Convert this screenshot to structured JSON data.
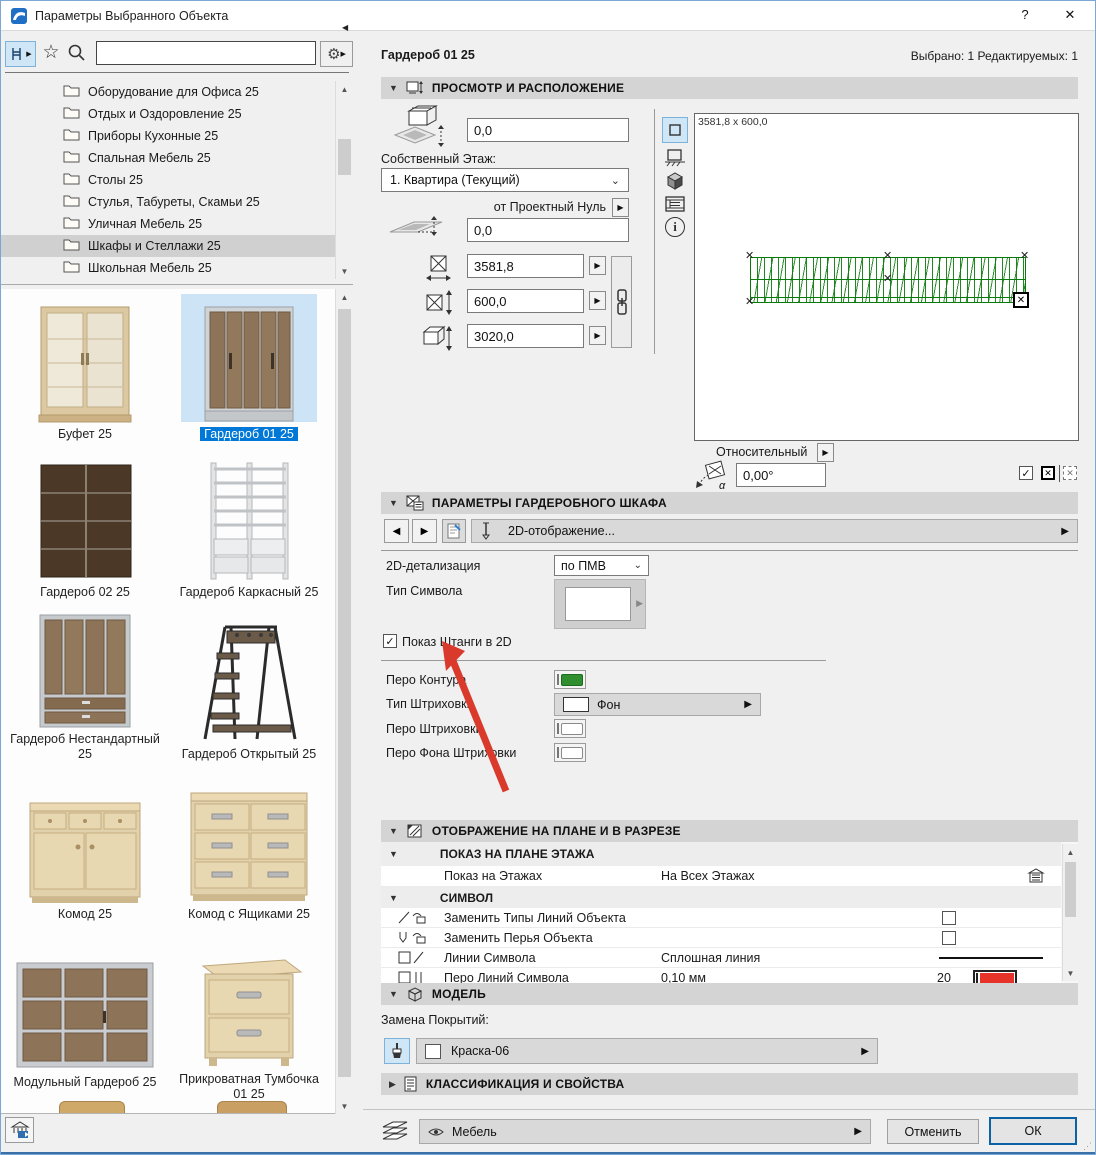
{
  "window": {
    "title": "Параметры Выбранного Объекта",
    "help": "?",
    "close": "✕"
  },
  "left": {
    "tree": {
      "items": [
        "Оборудование для Офиса 25",
        "Отдых и Оздоровление 25",
        "Приборы Кухонные 25",
        "Спальная Мебель 25",
        "Столы 25",
        "Стулья, Табуреты, Скамьи 25",
        "Уличная Мебель 25",
        "Шкафы и Стеллажи 25",
        "Школьная Мебель 25"
      ],
      "selected": "Шкафы и Стеллажи 25"
    },
    "thumbnails": [
      "Буфет 25",
      "Гардероб 01 25",
      "Гардероб 02 25",
      "Гардероб Каркасный 25",
      "Гардероб Нестандартный 25",
      "Гардероб Открытый 25",
      "Комод 25",
      "Комод с Ящиками 25",
      "Модульный Гардероб 25",
      "Прикроватная Тумбочка 01 25"
    ],
    "selected_thumbnail": "Гардероб 01 25"
  },
  "right": {
    "object_name": "Гардероб 01 25",
    "selection_status": "Выбрано: 1 Редактируемых: 1",
    "preview": {
      "title": "ПРОСМОТР И РАСПОЛОЖЕНИЕ",
      "top_elevation": "0,0",
      "home_story_label": "Собственный Этаж:",
      "home_story_value": "1. Квартира (Текущий)",
      "ref_level_label": "от Проектный Нуль",
      "bottom_elevation": "0,0",
      "dim_length": "3581,8",
      "dim_depth": "600,0",
      "dim_height": "3020,0",
      "canvas_dims": "3581,8 x 600,0",
      "relative_label": "Относительный",
      "angle_value": "0,00°"
    },
    "params": {
      "title": "ПАРАМЕТРЫ ГАРДЕРОБНОГО ШКАФА",
      "page_label": "2D-отображение...",
      "detail_label": "2D-детализация",
      "detail_value": "по ПМВ",
      "symbol_type_label": "Тип Символа",
      "show_bar_label": "Показ Штанги в 2D",
      "contour_pen_label": "Перо Контура",
      "fill_type_label": "Тип Штриховки",
      "fill_type_value": "Фон",
      "fill_pen_label": "Перо Штриховки",
      "fill_bg_pen_label": "Перо Фона Штриховки"
    },
    "floorplan": {
      "title": "ОТОБРАЖЕНИЕ НА ПЛАНЕ И В РАЗРЕЗЕ",
      "group1": "ПОКАЗ НА ПЛАНЕ ЭТАЖА",
      "show_on_stories_label": "Показ на Этажах",
      "show_on_stories_value": "На Всех Этажах",
      "group2": "СИМВОЛ",
      "override_line_types": "Заменить Типы Линий Объекта",
      "override_pens": "Заменить Перья Объекта",
      "symbol_lines_label": "Линии Символа",
      "symbol_lines_value": "Сплошная линия",
      "symbol_pen_label": "Перо Линий Символа",
      "symbol_pen_value": "0,10 мм",
      "symbol_pen_number": "20"
    },
    "model": {
      "title": "МОДЕЛЬ",
      "override_label": "Замена Покрытий:",
      "material_value": "Краска-06"
    },
    "classification": {
      "title": "КЛАССИФИКАЦИЯ И СВОЙСТВА"
    },
    "footer": {
      "layer_value": "Мебель",
      "cancel_label": "Отменить",
      "ok_label": "ОК"
    }
  },
  "colors": {
    "accent_blue": "#0b62a4",
    "selection_blue": "#0078d7",
    "selection_bg": "#cde4f7",
    "drawing_green": "#0a7a0a",
    "annotation_red": "#d93a2b",
    "contour_pen_green": "#2f8f2f",
    "symbol_pen_red": "#e63329"
  }
}
